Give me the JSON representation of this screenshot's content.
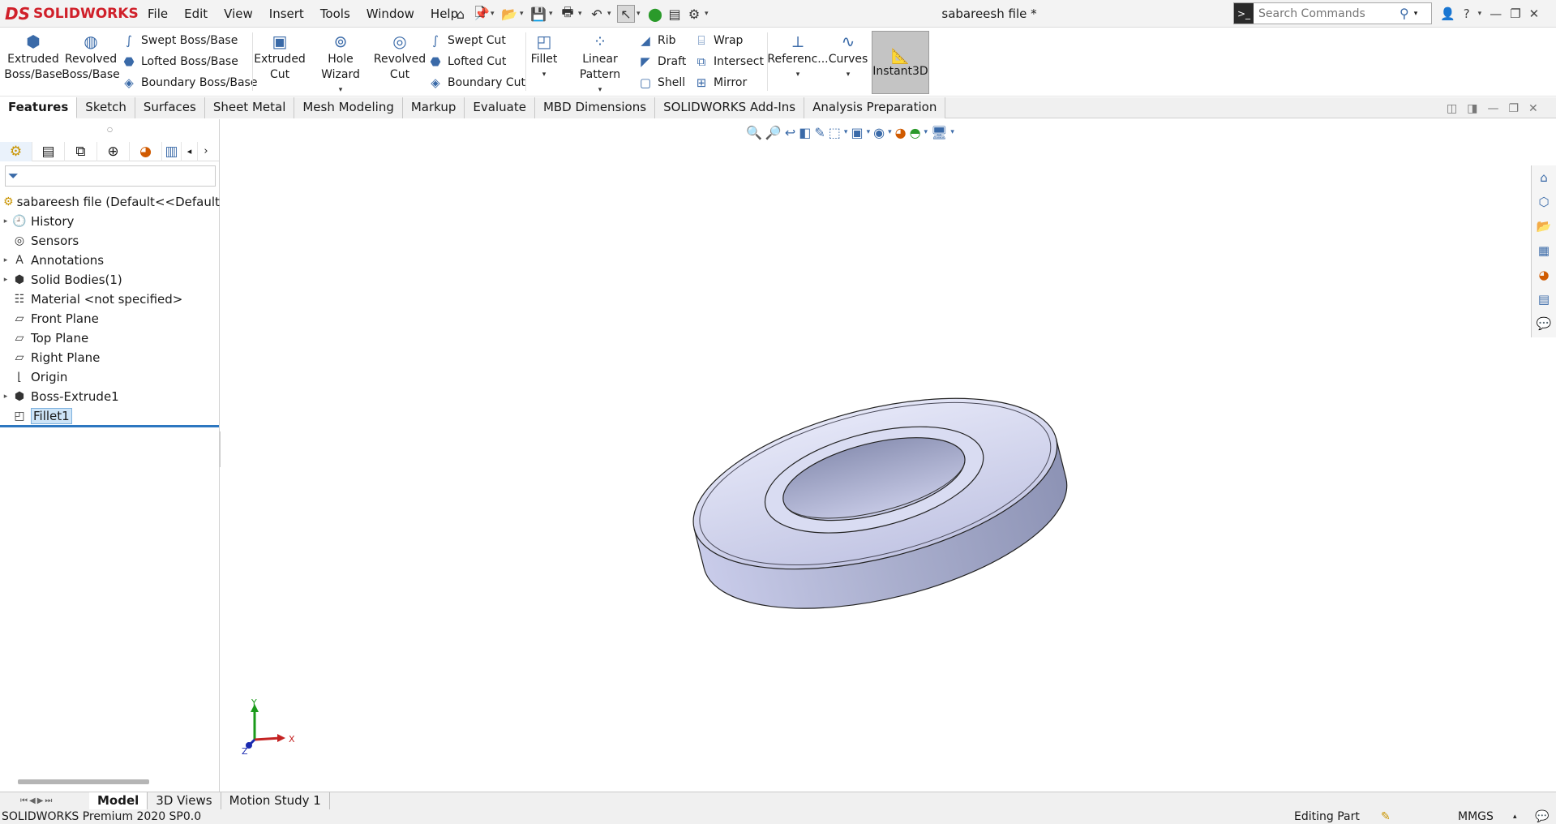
{
  "titlebar": {
    "brand": "SOLIDWORKS",
    "brand_prefix": "DS",
    "document_title": "sabareesh file *",
    "menu": [
      "File",
      "Edit",
      "View",
      "Insert",
      "Tools",
      "Window",
      "Help"
    ],
    "search_placeholder": "Search Commands"
  },
  "ribbon": {
    "extruded_boss": "Extruded Boss/Base",
    "revolved_boss": "Revolved Boss/Base",
    "swept_boss": "Swept Boss/Base",
    "lofted_boss": "Lofted Boss/Base",
    "boundary_boss": "Boundary Boss/Base",
    "extruded_cut": "Extruded Cut",
    "hole_wizard": "Hole Wizard",
    "revolved_cut": "Revolved Cut",
    "swept_cut": "Swept Cut",
    "lofted_cut": "Lofted Cut",
    "boundary_cut": "Boundary Cut",
    "fillet": "Fillet",
    "linear_pattern": "Linear Pattern",
    "rib": "Rib",
    "draft": "Draft",
    "shell": "Shell",
    "wrap": "Wrap",
    "intersect": "Intersect",
    "mirror": "Mirror",
    "reference": "Referenc...",
    "curves": "Curves",
    "instant3d": "Instant3D"
  },
  "tabs": [
    "Features",
    "Sketch",
    "Surfaces",
    "Sheet Metal",
    "Mesh Modeling",
    "Markup",
    "Evaluate",
    "MBD Dimensions",
    "SOLIDWORKS Add-Ins",
    "Analysis Preparation"
  ],
  "tree": {
    "root": "sabareesh file  (Default<<Default>_D",
    "items": [
      {
        "label": "History",
        "expandable": true,
        "icon": "history-icon"
      },
      {
        "label": "Sensors",
        "expandable": false,
        "icon": "sensors-icon"
      },
      {
        "label": "Annotations",
        "expandable": true,
        "icon": "annotations-icon"
      },
      {
        "label": "Solid Bodies(1)",
        "expandable": true,
        "icon": "solid-bodies-icon"
      },
      {
        "label": "Material <not specified>",
        "expandable": false,
        "icon": "material-icon"
      },
      {
        "label": "Front Plane",
        "expandable": false,
        "icon": "plane-icon"
      },
      {
        "label": "Top Plane",
        "expandable": false,
        "icon": "plane-icon"
      },
      {
        "label": "Right Plane",
        "expandable": false,
        "icon": "plane-icon"
      },
      {
        "label": "Origin",
        "expandable": false,
        "icon": "origin-icon"
      },
      {
        "label": "Boss-Extrude1",
        "expandable": true,
        "icon": "extrude-icon"
      },
      {
        "label": "Fillet1",
        "expandable": false,
        "icon": "fillet-icon",
        "selected": true
      }
    ]
  },
  "triad": {
    "x": "X",
    "y": "Y",
    "z": "Z"
  },
  "bottom_tabs": [
    "Model",
    "3D Views",
    "Motion Study 1"
  ],
  "status": {
    "product": "SOLIDWORKS Premium 2020 SP0.0",
    "mode": "Editing Part",
    "units": "MMGS"
  },
  "colors": {
    "brand": "#d0202a",
    "accent": "#2d77c0",
    "model_face": "#c8cbe8",
    "model_side": "#a6abc9"
  }
}
